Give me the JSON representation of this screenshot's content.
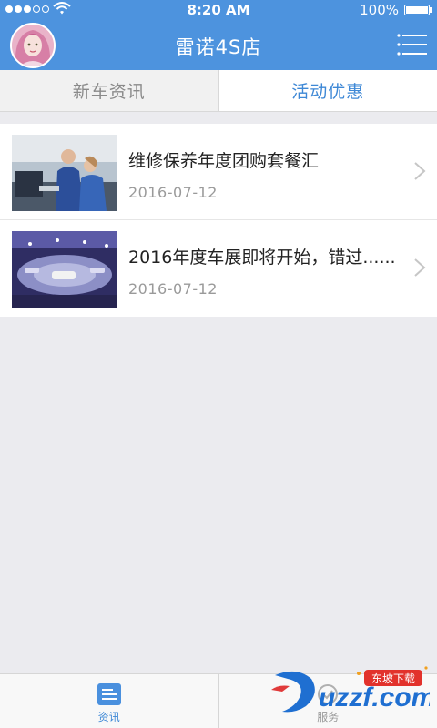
{
  "status_bar": {
    "time": "8:20 AM",
    "battery": "100%",
    "signal_filled": 3,
    "signal_total": 5
  },
  "nav": {
    "title": "雷诺4S店",
    "avatar_icon": "user-avatar",
    "menu_icon": "hamburger-menu-icon"
  },
  "tabs": [
    {
      "label": "新车资讯",
      "active": false
    },
    {
      "label": "活动优惠",
      "active": true
    }
  ],
  "list": [
    {
      "title": "维修保养年度团购套餐汇",
      "date": "2016-07-12",
      "thumb_icon": "mechanics-photo"
    },
    {
      "title": "2016年度车展即将开始，错过......",
      "date": "2016-07-12",
      "thumb_icon": "auto-show-photo"
    }
  ],
  "bottom_tabs": [
    {
      "label": "资讯",
      "icon": "news-icon",
      "active": true
    },
    {
      "label": "服务",
      "icon": "service-icon",
      "active": false
    }
  ],
  "watermark": {
    "brand": "uzzf.com",
    "tag": "东坡下载"
  },
  "colors": {
    "primary": "#4d93de",
    "active_text": "#3e88d6",
    "background": "#ebebef"
  }
}
